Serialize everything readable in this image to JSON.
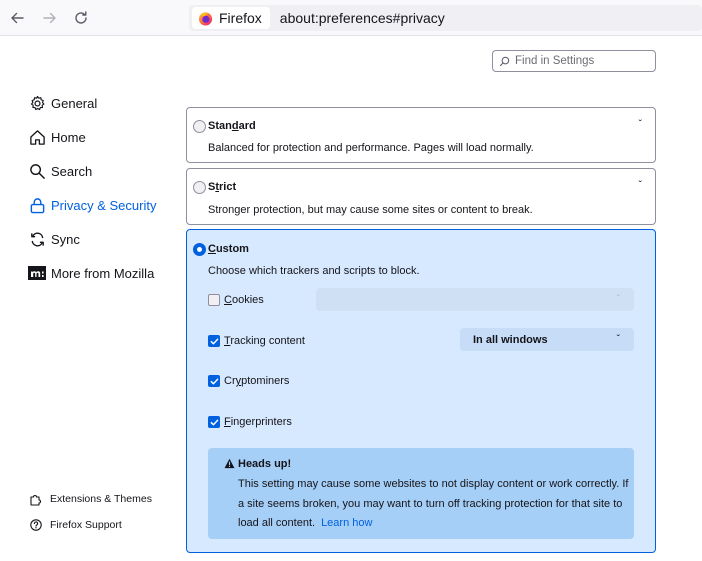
{
  "browser": {
    "identity_label": "Firefox",
    "url": "about:preferences#privacy"
  },
  "search": {
    "placeholder": "Find in Settings"
  },
  "sidebar": {
    "items": [
      {
        "label": "General",
        "icon": "gear-icon"
      },
      {
        "label": "Home",
        "icon": "home-icon"
      },
      {
        "label": "Search",
        "icon": "search-icon"
      },
      {
        "label": "Privacy & Security",
        "icon": "lock-icon",
        "active": true
      },
      {
        "label": "Sync",
        "icon": "sync-icon"
      },
      {
        "label": "More from Mozilla",
        "icon": "mozilla-icon"
      }
    ],
    "footer": [
      {
        "label": "Extensions & Themes",
        "icon": "puzzle-icon"
      },
      {
        "label": "Firefox Support",
        "icon": "help-icon"
      }
    ]
  },
  "protection": {
    "standard": {
      "title_pre": "Stan",
      "title_key": "d",
      "title_post": "ard",
      "description": "Balanced for protection and performance. Pages will load normally."
    },
    "strict": {
      "title_pre": "S",
      "title_key": "t",
      "title_post": "rict",
      "description": "Stronger protection, but may cause some sites or content to break."
    },
    "custom": {
      "title_key": "C",
      "title_post": "ustom",
      "description": "Choose which trackers and scripts to block.",
      "options": {
        "cookies": {
          "key": "C",
          "rest": "ookies",
          "checked": false
        },
        "tracking": {
          "key": "T",
          "rest": "racking content",
          "checked": true,
          "select_value": "In all windows"
        },
        "cryptominers": {
          "pre": "Cr",
          "key": "y",
          "rest": "ptominers",
          "checked": true
        },
        "fingerprinters": {
          "key": "F",
          "rest": "ingerprinters",
          "checked": true
        }
      },
      "warning": {
        "title": "Heads up!",
        "line1": "This setting may cause some websites to not display content or work correctly. If",
        "line2": "a site seems broken, you may want to turn off tracking protection for that site to",
        "line3": "load all content.",
        "link": "Learn how"
      }
    }
  },
  "colors": {
    "accent": "#0061e0",
    "custom_bg": "#d7e9fe",
    "warning_bg": "#a6cff7"
  }
}
